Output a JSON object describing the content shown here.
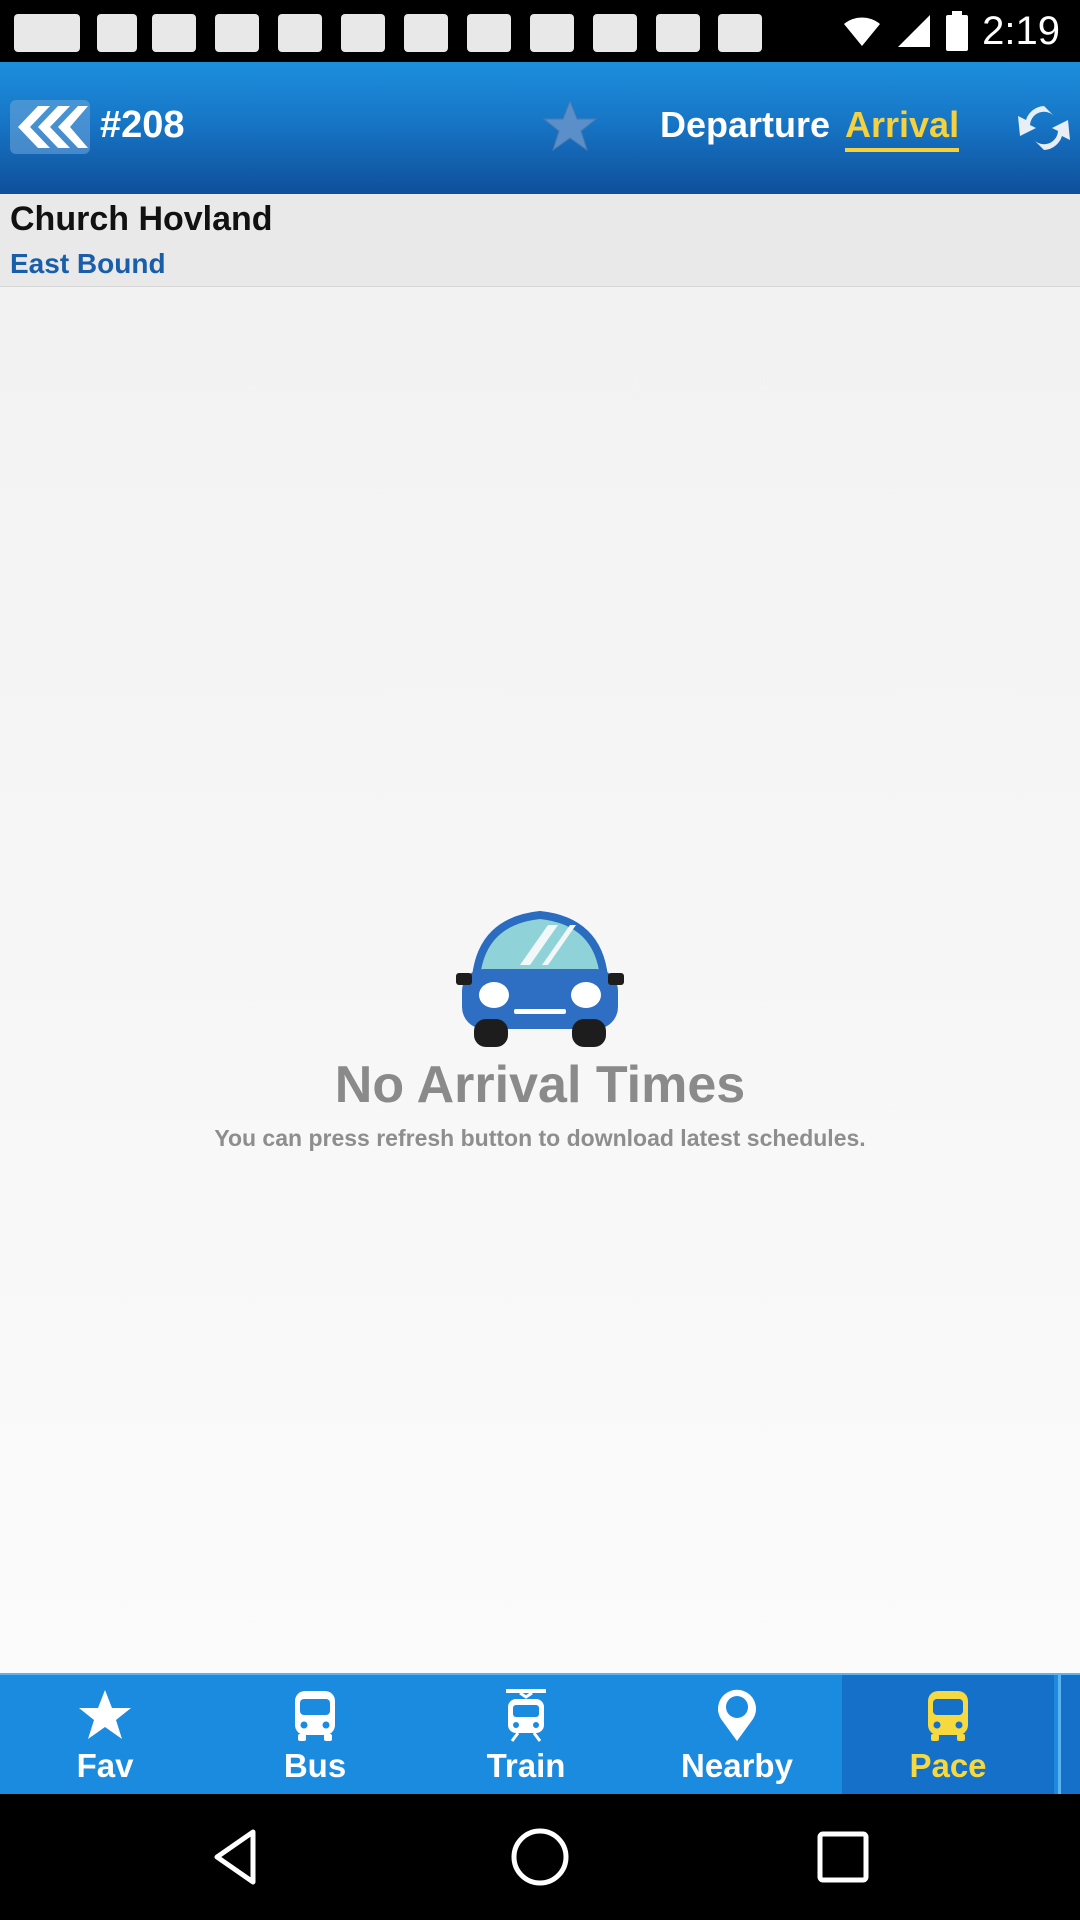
{
  "status_bar": {
    "time": "2:19"
  },
  "header": {
    "route": "#208",
    "tab_departure": "Departure",
    "tab_arrival": "Arrival",
    "active_tab": "Arrival"
  },
  "stop": {
    "name": "Church Hovland",
    "direction": "East Bound"
  },
  "empty_state": {
    "title": "No Arrival Times",
    "subtitle": "You can press refresh button to download latest schedules."
  },
  "bottom_nav": {
    "items": [
      {
        "label": "Fav",
        "icon": "star-icon"
      },
      {
        "label": "Bus",
        "icon": "bus-icon"
      },
      {
        "label": "Train",
        "icon": "train-icon"
      },
      {
        "label": "Nearby",
        "icon": "map-pin-icon"
      },
      {
        "label": "Pace",
        "icon": "pace-bus-icon"
      }
    ],
    "active": "Pace"
  },
  "colors": {
    "header_blue": "#1776c6",
    "active_yellow": "#f5d23d",
    "direction_blue": "#1a5ea9",
    "nav_blue": "#1b8be0"
  }
}
